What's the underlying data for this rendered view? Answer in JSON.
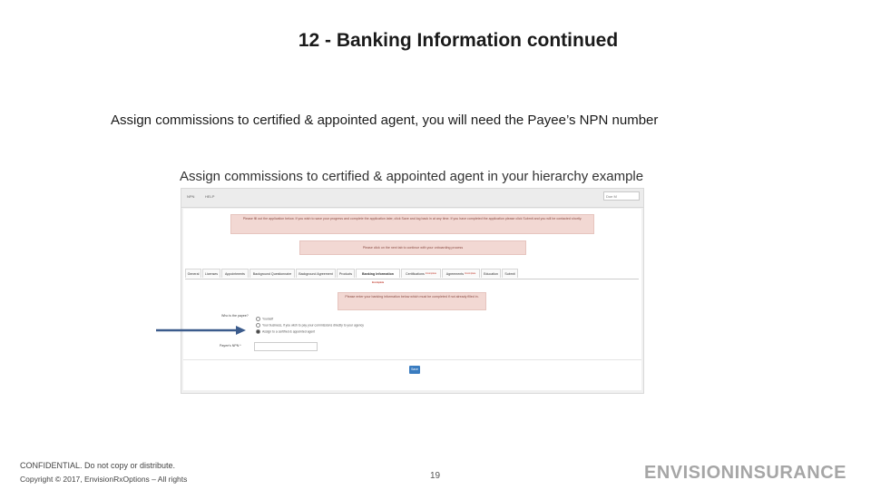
{
  "slide": {
    "title": "12 - Banking Information continued",
    "subtitle": "Assign commissions to certified & appointed agent, you will need the Payee’s NPN number",
    "caption": "Assign commissions to certified & appointed agent in your hierarchy example"
  },
  "screenshot": {
    "nav": [
      "NPN",
      "HELP"
    ],
    "search_value": "Doe M",
    "alert_top": "Please fill out the application below. If you wish to save your progress and complete the application later, click Save and log back in at any time. If you have completed the application please click Submit and you will be contacted shortly.",
    "alert_second": "Please click on the next tab to continue with your onboarding process",
    "tabs": [
      {
        "label": "General",
        "required": false
      },
      {
        "label": "Licenses",
        "required": false
      },
      {
        "label": "Appointments",
        "required": false
      },
      {
        "label": "Background Questionnaire",
        "required": false
      },
      {
        "label": "Background Agreement",
        "required": false
      },
      {
        "label": "Products",
        "required": false
      },
      {
        "label": "Banking Information",
        "required": true
      },
      {
        "label": "Certifications",
        "required": true
      },
      {
        "label": "Agreements",
        "required": true
      },
      {
        "label": "Education",
        "required": false
      },
      {
        "label": "Submit",
        "required": false
      }
    ],
    "required_mark": "Incomplete",
    "alert_banking": "Please enter your banking information below which must be completed if not already filled in.",
    "payee_question": "Who is the payee?",
    "radio_options": [
      {
        "label": "Yourself",
        "selected": false
      },
      {
        "label": "Your business, if you wish to pay your commissions directly to your agency",
        "selected": false
      },
      {
        "label": "Assign to a certified & appointed agent",
        "selected": true
      }
    ],
    "payee_npn_label": "Payee’s NPN *",
    "save_label": "Save"
  },
  "footer": {
    "confidential": "CONFIDENTIAL. Do not copy or distribute.",
    "copyright": "Copyright © 2017, EnvisionRxOptions – All rights",
    "page_number": "19",
    "logo_text": "ENVISIONINSURANCE"
  },
  "colors": {
    "alert_bg": "#f2d8d3",
    "button_blue": "#3a7cc0",
    "arrow": "#3b5b8c",
    "logo_gray": "#a6a6a6"
  }
}
